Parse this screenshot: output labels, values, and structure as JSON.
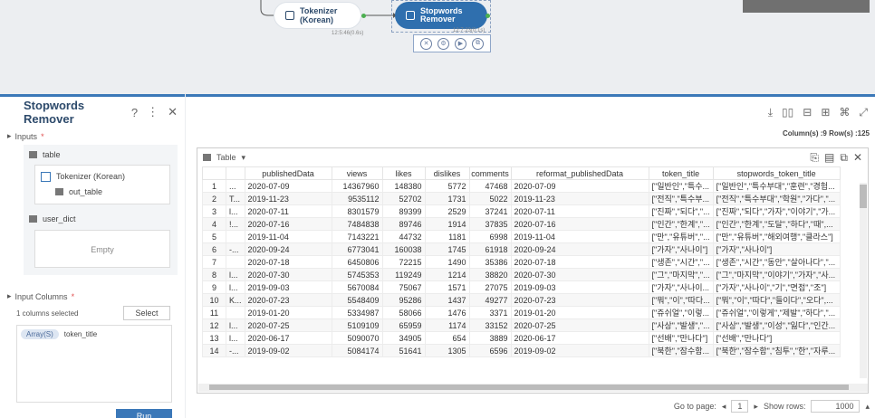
{
  "canvas": {
    "node_tokenizer": {
      "label": "Tokenizer (Korean)",
      "timestamp": "12:5:46(0.6s)"
    },
    "node_stopwords": {
      "label": "Stopwords Remover",
      "timestamp": "12:7:23(0.1s)"
    }
  },
  "left": {
    "title": "Stopwords Remover",
    "inputs_label": "Inputs",
    "table_label": "table",
    "tokenizer_label": "Tokenizer (Korean)",
    "out_table_label": "out_table",
    "user_dict_label": "user_dict",
    "empty_label": "Empty",
    "input_columns_label": "Input Columns",
    "columns_selected": "1 columns selected",
    "select_label": "Select",
    "chip_type": "Array(S)",
    "chip_column": "token_title",
    "run_label": "Run"
  },
  "right": {
    "meta": "Column(s) :9   Row(s) :125",
    "table_label": "Table",
    "columns": [
      "",
      "",
      "publishedData",
      "views",
      "likes",
      "dislikes",
      "comments",
      "reformat_publishedData",
      "token_title",
      "stopwords_token_title"
    ],
    "rows": [
      [
        "1",
        "...",
        "2020-07-09",
        "14367960",
        "148380",
        "5772",
        "47468",
        "2020-07-09",
        "[\"일반인\",\"특수...",
        "[\"일반인\",\"특수부대\",\"훈련\",\"경험..."
      ],
      [
        "2",
        "T...",
        "2019-11-23",
        "9535112",
        "52702",
        "1731",
        "5022",
        "2019-11-23",
        "[\"전직\",\"특수부...",
        "[\"전직\",\"특수부대\",\"학원\",\"가다\",\"..."
      ],
      [
        "3",
        "l...",
        "2020-07-11",
        "8301579",
        "89399",
        "2529",
        "37241",
        "2020-07-11",
        "[\"진짜\",\"되다\",\"...",
        "[\"진짜\",\"되다\",\"가자\",\"이야기\",\"가..."
      ],
      [
        "4",
        "!...",
        "2020-07-16",
        "7484838",
        "89746",
        "1914",
        "37835",
        "2020-07-16",
        "[\"인간\",\"한계\",\"...",
        "[\"인간\",\"한계\",\"도달\",\"하다\",\"때\",..."
      ],
      [
        "5",
        "",
        "2019-11-04",
        "7143221",
        "44732",
        "1181",
        "6998",
        "2019-11-04",
        "[\"만\",\"유튜버\",\"...",
        "[\"만\",\"유튜버\",\"해외여행\",\"클라스\"]"
      ],
      [
        "6",
        "-...",
        "2020-09-24",
        "6773041",
        "160038",
        "1745",
        "61918",
        "2020-09-24",
        "[\"가자\",\"사나이\"]",
        "[\"가자\",\"사나이\"]"
      ],
      [
        "7",
        "",
        "2020-07-18",
        "6450806",
        "72215",
        "1490",
        "35386",
        "2020-07-18",
        "[\"생존\",\"시간\",\"...",
        "[\"생존\",\"시간\",\"동안\",\"살아나다\",\"..."
      ],
      [
        "8",
        "l...",
        "2020-07-30",
        "5745353",
        "119249",
        "1214",
        "38820",
        "2020-07-30",
        "[\"그\",\"마지막\",\"...",
        "[\"그\",\"마지막\",\"이야기\",\"가자\",\"사..."
      ],
      [
        "9",
        "l...",
        "2019-09-03",
        "5670084",
        "75067",
        "1571",
        "27075",
        "2019-09-03",
        "[\"가자\",\"사나이...",
        "[\"가자\",\"사나이\",\"기\",\"면접\",\"조\"]"
      ],
      [
        "10",
        "K...",
        "2020-07-23",
        "5548409",
        "95286",
        "1437",
        "49277",
        "2020-07-23",
        "[\"뭐\",\"이\",\"따다...",
        "[\"뭐\",\"이\",\"따다\",\"들이다\",\"오다\",..."
      ],
      [
        "11",
        "",
        "2019-01-20",
        "5334987",
        "58066",
        "1476",
        "3371",
        "2019-01-20",
        "[\"쥬쉬얼\",\"이렇...",
        "[\"쥬쉬얼\",\"이렇게\",\"제발\",\"하다\",\"..."
      ],
      [
        "12",
        "l...",
        "2020-07-25",
        "5109109",
        "65959",
        "1174",
        "33152",
        "2020-07-25",
        "[\"사상\",\"발생\",\"...",
        "[\"사상\",\"발생\",\"이성\",\"잃다\",\"인간..."
      ],
      [
        "13",
        "l...",
        "2020-06-17",
        "5090070",
        "34905",
        "654",
        "3889",
        "2020-06-17",
        "[\"선배\",\"만나다\"]",
        "[\"선배\",\"만나다\"]"
      ],
      [
        "14",
        "-...",
        "2019-09-02",
        "5084174",
        "51641",
        "1305",
        "6596",
        "2019-09-02",
        "[\"북한\",\"잠수함...",
        "[\"북한\",\"잠수함\",\"침투\",\"한\",\"자루..."
      ]
    ],
    "pager": {
      "go_to_label": "Go to page:",
      "page": "1",
      "show_rows_label": "Show rows:",
      "rows_value": "1000"
    }
  }
}
